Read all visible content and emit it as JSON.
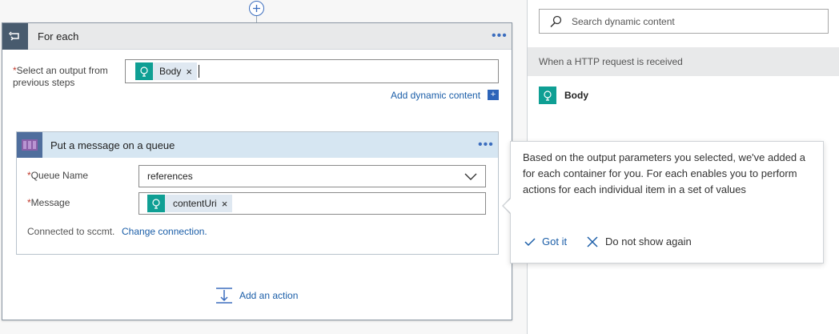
{
  "foreach": {
    "title": "For each",
    "select_label": "Select an output from previous steps",
    "select_token": "Body",
    "add_dynamic_label": "Add dynamic content",
    "add_dynamic_plus": "+",
    "add_action_label": "Add an action",
    "queue_card": {
      "title": "Put a message on a queue",
      "queue_name_label": "Queue Name",
      "queue_name_value": "references",
      "message_label": "Message",
      "message_token": "contentUri",
      "connected_text": "Connected to sccmt.",
      "change_connection_label": "Change connection."
    }
  },
  "dynamic_panel": {
    "search_placeholder": "Search dynamic content",
    "trigger_header": "When a HTTP request is received",
    "items": [
      {
        "label": "Body",
        "icon": "http-request-icon"
      }
    ]
  },
  "callout": {
    "text": "Based on the output parameters you selected, we've added a for each container for you. For each enables you to perform actions for each individual item in a set of values",
    "got_it_label": "Got it",
    "dont_show_label": "Do not show again"
  },
  "colors": {
    "accent": "#1b5ea8",
    "token_icon": "#0f9f94",
    "foreach_icon_bg": "#485b6e",
    "queue_header_bg": "#d6e6f2"
  }
}
